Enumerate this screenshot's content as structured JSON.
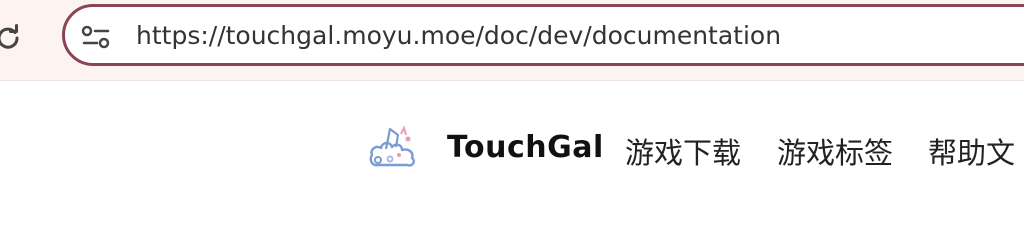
{
  "browser": {
    "url": "https://touchgal.moyu.moe/doc/dev/documentation",
    "reload_icon": "reload-icon",
    "site_info_icon": "tune-icon",
    "accent_color": "#8b4456"
  },
  "navbar": {
    "brand_name": "TouchGal",
    "logo_icon": "touchgal-logo",
    "links": [
      {
        "label": "游戏下载"
      },
      {
        "label": "游戏标签"
      },
      {
        "label": "帮助文"
      }
    ]
  }
}
